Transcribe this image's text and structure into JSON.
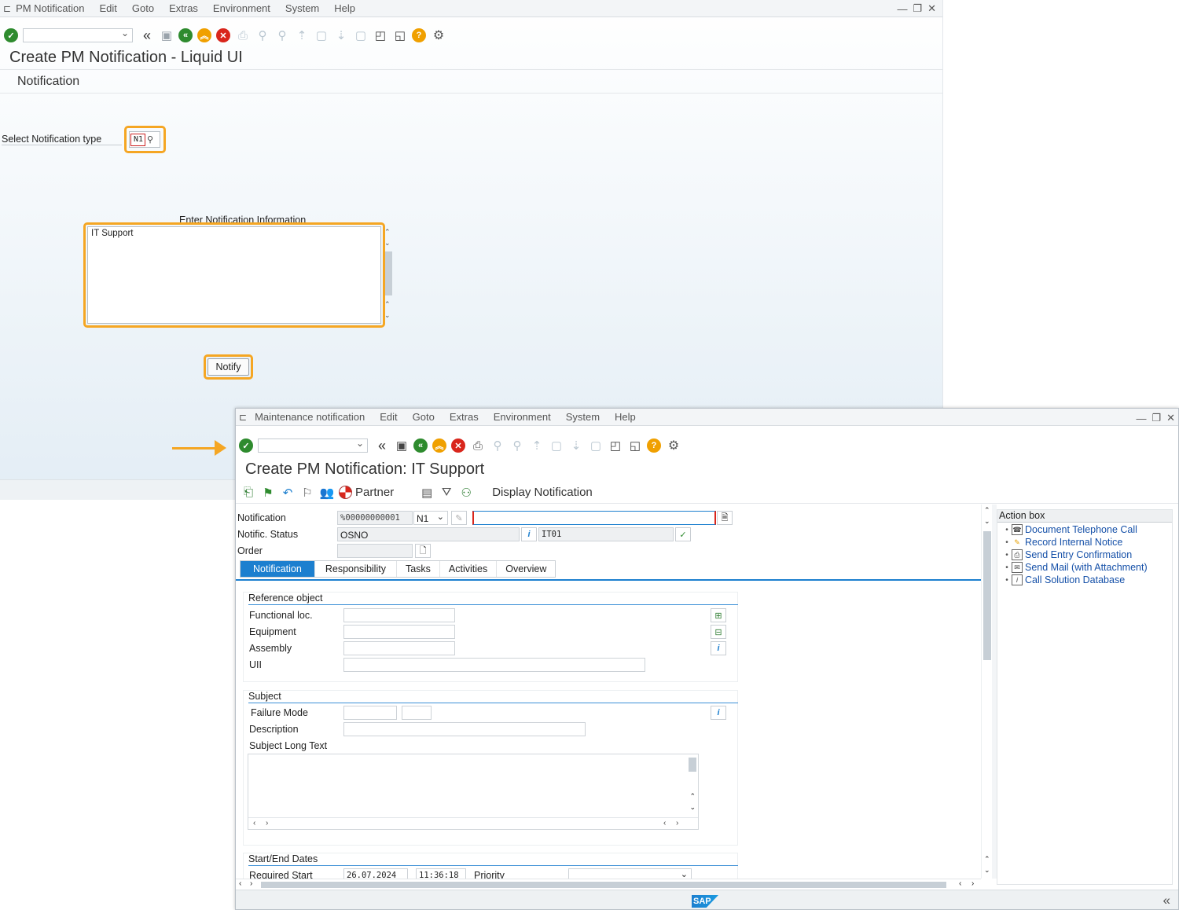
{
  "back_window": {
    "menu": [
      "PM Notification",
      "Edit",
      "Goto",
      "Extras",
      "Environment",
      "System",
      "Help"
    ],
    "title": "Create PM Notification - Liquid UI",
    "subtitle": "Notification",
    "select_label": "Select Notification type",
    "notification_type": "N1",
    "info_label": "Enter Notification Information",
    "info_text": "IT Support",
    "notify_button": "Notify"
  },
  "front_window": {
    "menu": [
      "Maintenance notification",
      "Edit",
      "Goto",
      "Extras",
      "Environment",
      "System",
      "Help"
    ],
    "title": "Create PM Notification: IT Support",
    "app_toolbar": {
      "partner_label": "Partner",
      "display_label": "Display Notification"
    },
    "header": {
      "notification_label": "Notification",
      "notification_value": "%00000000001",
      "notification_type": "N1",
      "status_label": "Notific. Status",
      "status_value": "OSNO",
      "status_code": "IT01",
      "order_label": "Order"
    },
    "tabs": [
      "Notification",
      "Responsibility",
      "Tasks",
      "Activities",
      "Overview"
    ],
    "reference_object": {
      "title": "Reference object",
      "functional_loc": "Functional loc.",
      "equipment": "Equipment",
      "assembly": "Assembly",
      "uii": "UII"
    },
    "subject": {
      "title": "Subject",
      "failure_mode": "Failure Mode",
      "description": "Description",
      "long_text": "Subject Long Text"
    },
    "dates": {
      "title": "Start/End Dates",
      "required_start": "Required Start",
      "date": "26.07.2024",
      "time": "11:36:18",
      "priority": "Priority"
    },
    "action_box": {
      "title": "Action box",
      "items": [
        "Document Telephone Call",
        "Record Internal Notice",
        "Send Entry Confirmation",
        "Send Mail (with Attachment)",
        "Call Solution Database"
      ]
    },
    "footer_logo": "SAP"
  },
  "colors": {
    "accent": "#f5a623",
    "tab_active": "#1c7fcf",
    "link": "#1550a8"
  }
}
